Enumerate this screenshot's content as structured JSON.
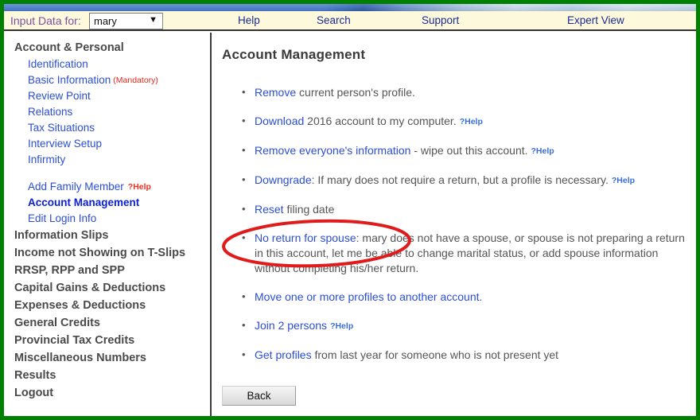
{
  "topnav": {
    "input_data_label": "Input Data for:",
    "selected_person": "mary",
    "select_arrow": "▼",
    "links": [
      {
        "label": "Help"
      },
      {
        "label": "Search"
      },
      {
        "label": "Support"
      },
      {
        "label": "Expert View"
      }
    ]
  },
  "sidebar": {
    "section_account_personal": "Account & Personal",
    "items": [
      {
        "label": "Identification"
      },
      {
        "label": "Basic Information",
        "tag": "(Mandatory)"
      },
      {
        "label": "Review Point"
      },
      {
        "label": "Relations"
      },
      {
        "label": "Tax Situations"
      },
      {
        "label": "Interview Setup"
      },
      {
        "label": "Infirmity"
      }
    ],
    "add_family_member": "Add Family Member",
    "add_family_member_help": "?Help",
    "account_management": "Account Management",
    "edit_login_info": "Edit Login Info",
    "sections": [
      {
        "label": "Information Slips"
      },
      {
        "label": "Income not Showing on T-Slips"
      },
      {
        "label": "RRSP, RPP and SPP"
      },
      {
        "label": "Capital Gains & Deductions"
      },
      {
        "label": "Expenses & Deductions"
      },
      {
        "label": "General Credits"
      },
      {
        "label": "Provincial Tax Credits"
      },
      {
        "label": "Miscellaneous Numbers"
      },
      {
        "label": "Results"
      },
      {
        "label": "Logout"
      }
    ]
  },
  "main": {
    "title": "Account Management",
    "bullets": {
      "remove_link": "Remove",
      "remove_rest": " current person's profile.",
      "download_link": "Download",
      "download_rest": " 2016 account to my computer.",
      "download_help": "?Help",
      "remove_everyone_link": "Remove everyone's information",
      "remove_everyone_rest": " - wipe out this account.",
      "remove_everyone_help": "?Help",
      "downgrade_link": "Downgrade",
      "downgrade_rest": ": If mary does not require a return, but a profile is necessary.",
      "downgrade_help": "?Help",
      "reset_link": "Reset",
      "reset_rest": " filing date",
      "spouse_link": "No return for spouse",
      "spouse_rest": ": mary does not have a spouse, or spouse is not preparing a return in this account, let me be able to change marital status, or add spouse information without completing his/her return.",
      "move_link": "Move one or more profiles to another account.",
      "join_link": "Join 2 persons",
      "join_help": "?Help",
      "getprofiles_link": "Get profiles",
      "getprofiles_rest": " from last year for someone who is not present yet"
    },
    "back_button": "Back"
  },
  "annotation": {
    "shape": "red-ellipse",
    "color": "#e01b1b",
    "targets": "No return for spouse"
  },
  "colors": {
    "window_border": "#008000",
    "nav_background": "#fdf9dd",
    "nav_link": "#1b2a8f",
    "sidebar_link": "#2b4ed4",
    "body_text": "#555555",
    "mandatory_red": "#e0281e",
    "annotation_red": "#e01b1b"
  }
}
